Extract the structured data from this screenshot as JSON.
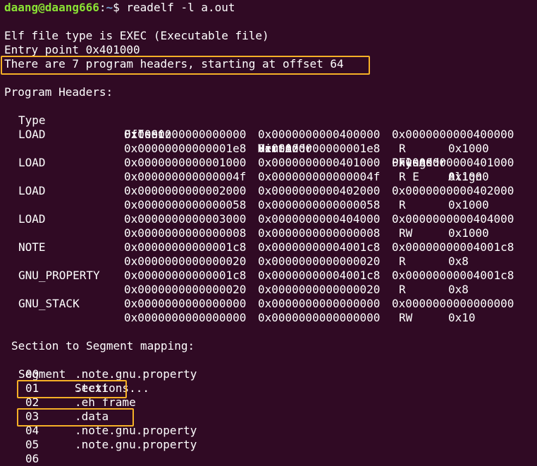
{
  "prompt": {
    "user_host": "daang@daang666",
    "separator": ":",
    "path": "~",
    "symbol": "$ ",
    "command": "readelf -l a.out"
  },
  "header": {
    "file_type": "Elf file type is EXEC (Executable file)",
    "entry_point": "Entry point 0x401000",
    "program_header_info": "There are 7 program headers, starting at offset 64"
  },
  "program_headers": {
    "title": "Program Headers:",
    "col_labels": {
      "type": "Type",
      "offset": "Offset",
      "virtaddr": "VirtAddr",
      "physaddr": "PhysAddr",
      "filesiz": "FileSiz",
      "memsiz": "MemSiz",
      "flags": "Flags",
      "align": "Align"
    },
    "rows": [
      {
        "type": "LOAD",
        "offset": "0x0000000000000000",
        "virtaddr": "0x0000000000400000",
        "physaddr": "0x0000000000400000",
        "filesiz": "0x00000000000001e8",
        "memsiz": "0x00000000000001e8",
        "flags": "R",
        "align": "0x1000"
      },
      {
        "type": "LOAD",
        "offset": "0x0000000000001000",
        "virtaddr": "0x0000000000401000",
        "physaddr": "0x0000000000401000",
        "filesiz": "0x000000000000004f",
        "memsiz": "0x000000000000004f",
        "flags": "R E",
        "align": "0x1000"
      },
      {
        "type": "LOAD",
        "offset": "0x0000000000002000",
        "virtaddr": "0x0000000000402000",
        "physaddr": "0x0000000000402000",
        "filesiz": "0x0000000000000058",
        "memsiz": "0x0000000000000058",
        "flags": "R",
        "align": "0x1000"
      },
      {
        "type": "LOAD",
        "offset": "0x0000000000003000",
        "virtaddr": "0x0000000000404000",
        "physaddr": "0x0000000000404000",
        "filesiz": "0x0000000000000008",
        "memsiz": "0x0000000000000008",
        "flags": "RW",
        "align": "0x1000"
      },
      {
        "type": "NOTE",
        "offset": "0x00000000000001c8",
        "virtaddr": "0x00000000004001c8",
        "physaddr": "0x00000000004001c8",
        "filesiz": "0x0000000000000020",
        "memsiz": "0x0000000000000020",
        "flags": "R",
        "align": "0x8"
      },
      {
        "type": "GNU_PROPERTY",
        "offset": "0x00000000000001c8",
        "virtaddr": "0x00000000004001c8",
        "physaddr": "0x00000000004001c8",
        "filesiz": "0x0000000000000020",
        "memsiz": "0x0000000000000020",
        "flags": "R",
        "align": "0x8"
      },
      {
        "type": "GNU_STACK",
        "offset": "0x0000000000000000",
        "virtaddr": "0x0000000000000000",
        "physaddr": "0x0000000000000000",
        "filesiz": "0x0000000000000000",
        "memsiz": "0x0000000000000000",
        "flags": "RW",
        "align": "0x10"
      }
    ]
  },
  "section_mapping": {
    "title": "Section to Segment mapping:",
    "col_segment": "Segment",
    "col_sections": "Sections...",
    "rows": [
      {
        "segment": "00",
        "sections": ".note.gnu.property"
      },
      {
        "segment": "01",
        "sections": ".text"
      },
      {
        "segment": "02",
        "sections": ".eh_frame"
      },
      {
        "segment": "03",
        "sections": ".data"
      },
      {
        "segment": "04",
        "sections": ".note.gnu.property"
      },
      {
        "segment": "05",
        "sections": ".note.gnu.property"
      },
      {
        "segment": "06",
        "sections": ""
      }
    ]
  },
  "colors": {
    "background": "#300a24",
    "text": "#ffffff",
    "prompt_user": "#8ae234",
    "prompt_path": "#729fcf",
    "highlight_box": "#f5b027"
  }
}
